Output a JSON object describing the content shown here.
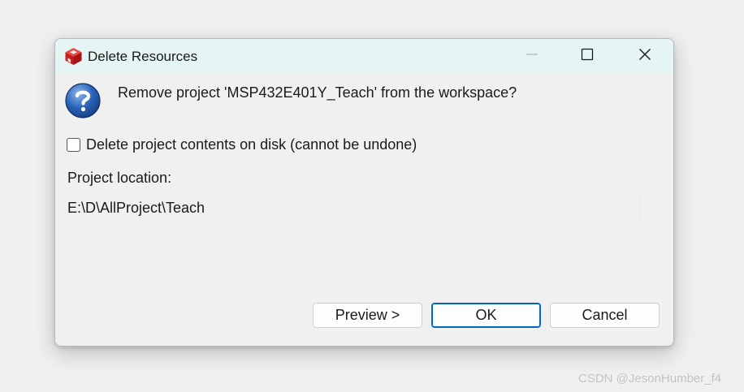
{
  "window": {
    "title": "Delete Resources",
    "controls": {
      "minimize": "minimize-icon",
      "maximize": "maximize-icon",
      "close": "close-icon"
    }
  },
  "icons": {
    "app": "ccs-cube-icon",
    "question": "question-icon"
  },
  "message": "Remove project 'MSP432E401Y_Teach' from the workspace?",
  "delete_contents": {
    "label": "Delete project contents on disk (cannot be undone)",
    "checked": false
  },
  "location": {
    "label": "Project location:",
    "value": "E:\\D\\AllProject\\Teach"
  },
  "buttons": {
    "preview": "Preview >",
    "ok": "OK",
    "cancel": "Cancel"
  },
  "colors": {
    "titlebar": "#e4f5f4",
    "app_icon_red": "#d42a2a",
    "question_blue": "#2a64b8",
    "default_button_border": "#0067c0"
  },
  "watermark": "CSDN @JesonHumber_f4"
}
